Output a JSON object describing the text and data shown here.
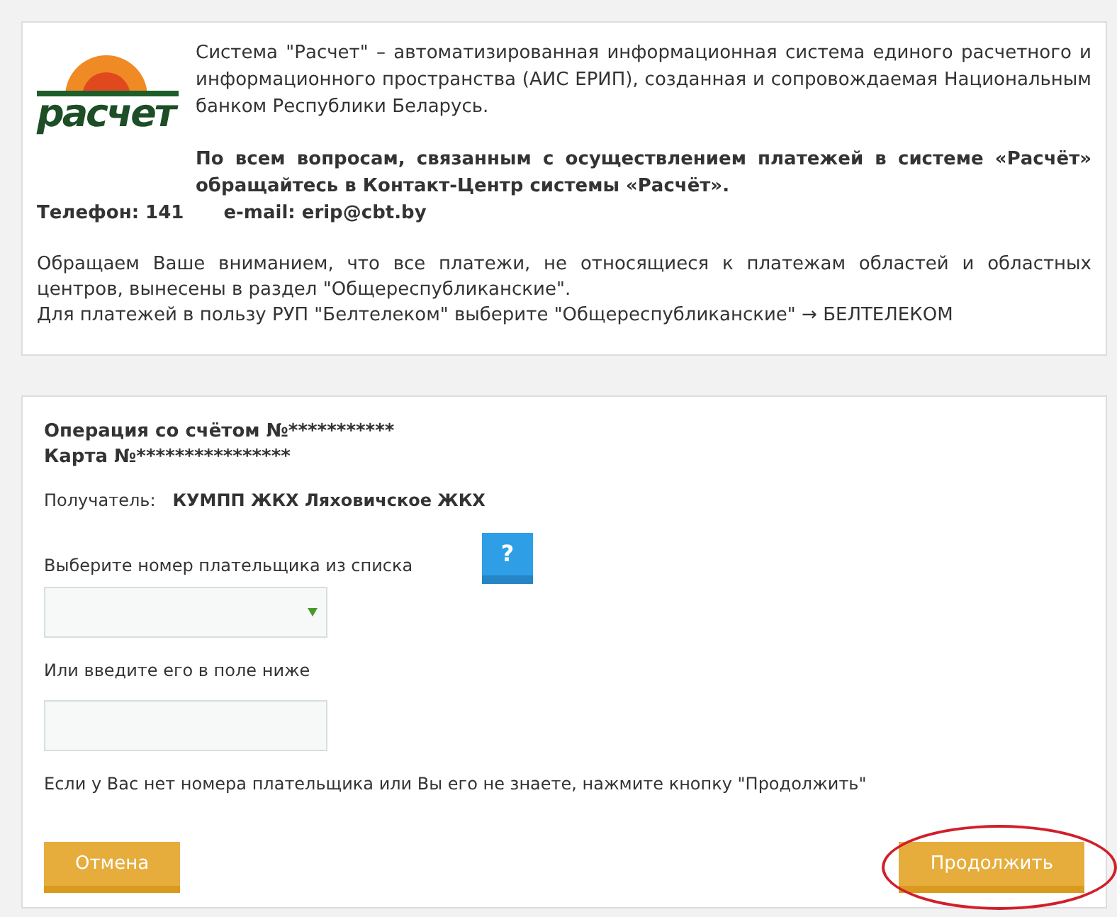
{
  "info": {
    "logo_text": "расчет",
    "intro": "Система \"Расчет\" – автоматизированная информационная система единого расчетного и информационного пространства (АИС ЕРИП), созданная и сопровождаемая Национальным банком Республики Беларусь.",
    "contact_note": "По всем вопросам, связанным с осуществлением платежей в системе «Расчёт» обращайтесь в Контакт-Центр системы «Расчёт».",
    "phone": "Телефон: 141",
    "email": "e-mail: erip@cbt.by",
    "notice": "Обращаем Ваше вниманием, что все платежи, не относящиеся к платежам областей и областных центров, вынесены в раздел \"Общереспубликанские\".",
    "beltelecom": "Для платежей в пользу РУП \"Белтелеком\" выберите \"Общереспубликанские\" → БЕЛТЕЛЕКОМ"
  },
  "form": {
    "account": "Операция со счётом №***********",
    "card": "Карта №****************",
    "recipient_label": "Получатель:",
    "recipient": "КУМПП ЖКХ Ляховичское ЖКХ",
    "select_label": "Выберите номер плательщика из списка",
    "help_button": "?",
    "input_label": "Или введите его в поле ниже",
    "hint": "Если у Вас нет номера плательщика или Вы его не знаете, нажмите кнопку \"Продолжить\"",
    "buttons": [
      {
        "label": "Отмена",
        "highlighted": false
      },
      {
        "label": "Продолжить",
        "highlighted": true
      }
    ]
  }
}
